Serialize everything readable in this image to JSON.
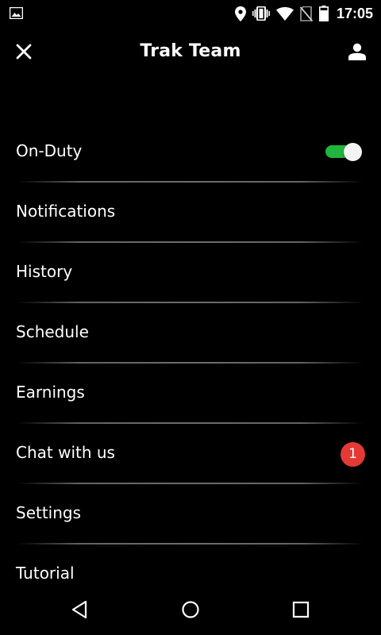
{
  "status_bar": {
    "time": "17:05",
    "icons": [
      "image-icon",
      "location-icon",
      "vibrate-icon",
      "wifi-icon",
      "no-sim-icon",
      "battery-icon"
    ]
  },
  "app_bar": {
    "title": "Trak Team",
    "left_icon": "close-icon",
    "right_icon": "profile-icon"
  },
  "menu": {
    "items": [
      {
        "label": "On-Duty",
        "toggle_on": true
      },
      {
        "label": "Notifications"
      },
      {
        "label": "History"
      },
      {
        "label": "Schedule"
      },
      {
        "label": "Earnings"
      },
      {
        "label": "Chat with us",
        "badge": "1"
      },
      {
        "label": "Settings"
      },
      {
        "label": "Tutorial"
      }
    ]
  },
  "nav_bar": {
    "icons": [
      "back-icon",
      "home-icon",
      "recents-icon"
    ]
  },
  "colors": {
    "background": "#000000",
    "text": "#ffffff",
    "toggle_track": "#1fb53f",
    "badge": "#e53935"
  }
}
